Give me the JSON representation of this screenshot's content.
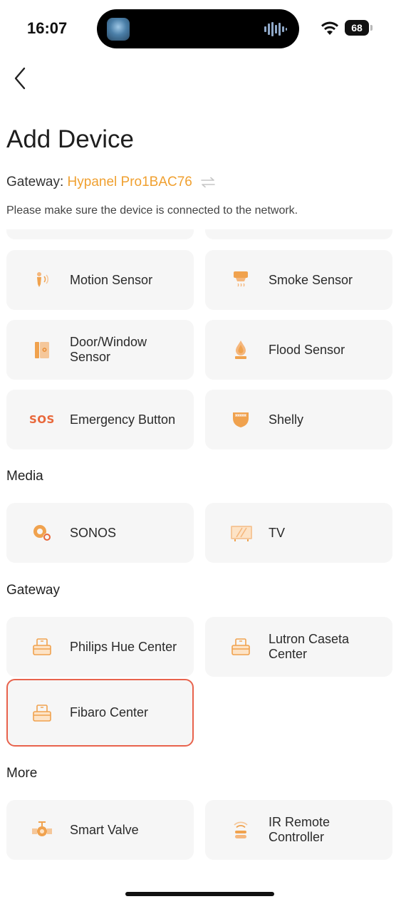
{
  "status_bar": {
    "time": "16:07",
    "battery": "68"
  },
  "page": {
    "title": "Add Device",
    "gateway_label": "Gateway:",
    "gateway_name": "Hypanel Pro1BAC76",
    "hint": "Please make sure the device is connected to the network."
  },
  "accent_color": "#f0a030",
  "highlight_color": "#e8624c",
  "sections": {
    "media": "Media",
    "gateway": "Gateway",
    "more": "More"
  },
  "devices": {
    "motion_sensor": {
      "label": "Motion Sensor",
      "icon": "motion-sensor-icon"
    },
    "smoke_sensor": {
      "label": "Smoke Sensor",
      "icon": "smoke-sensor-icon"
    },
    "door_window_sensor": {
      "label": "Door/Window\nSensor",
      "icon": "door-window-sensor-icon"
    },
    "flood_sensor": {
      "label": "Flood Sensor",
      "icon": "flood-sensor-icon"
    },
    "emergency_button": {
      "label": "Emergency Button",
      "icon": "sos-icon",
      "icon_text": "SOS"
    },
    "shelly": {
      "label": "Shelly",
      "icon": "shelly-icon"
    },
    "sonos": {
      "label": "SONOS",
      "icon": "sonos-icon"
    },
    "tv": {
      "label": "TV",
      "icon": "tv-icon"
    },
    "philips_hue": {
      "label": "Philips Hue Center",
      "icon": "hub-icon"
    },
    "lutron_caseta": {
      "label": "Lutron Caseta\nCenter",
      "icon": "hub-icon"
    },
    "fibaro": {
      "label": "Fibaro Center",
      "icon": "hub-icon"
    },
    "smart_valve": {
      "label": "Smart Valve",
      "icon": "valve-icon"
    },
    "ir_remote": {
      "label": "IR Remote\nController",
      "icon": "ir-remote-icon"
    }
  }
}
